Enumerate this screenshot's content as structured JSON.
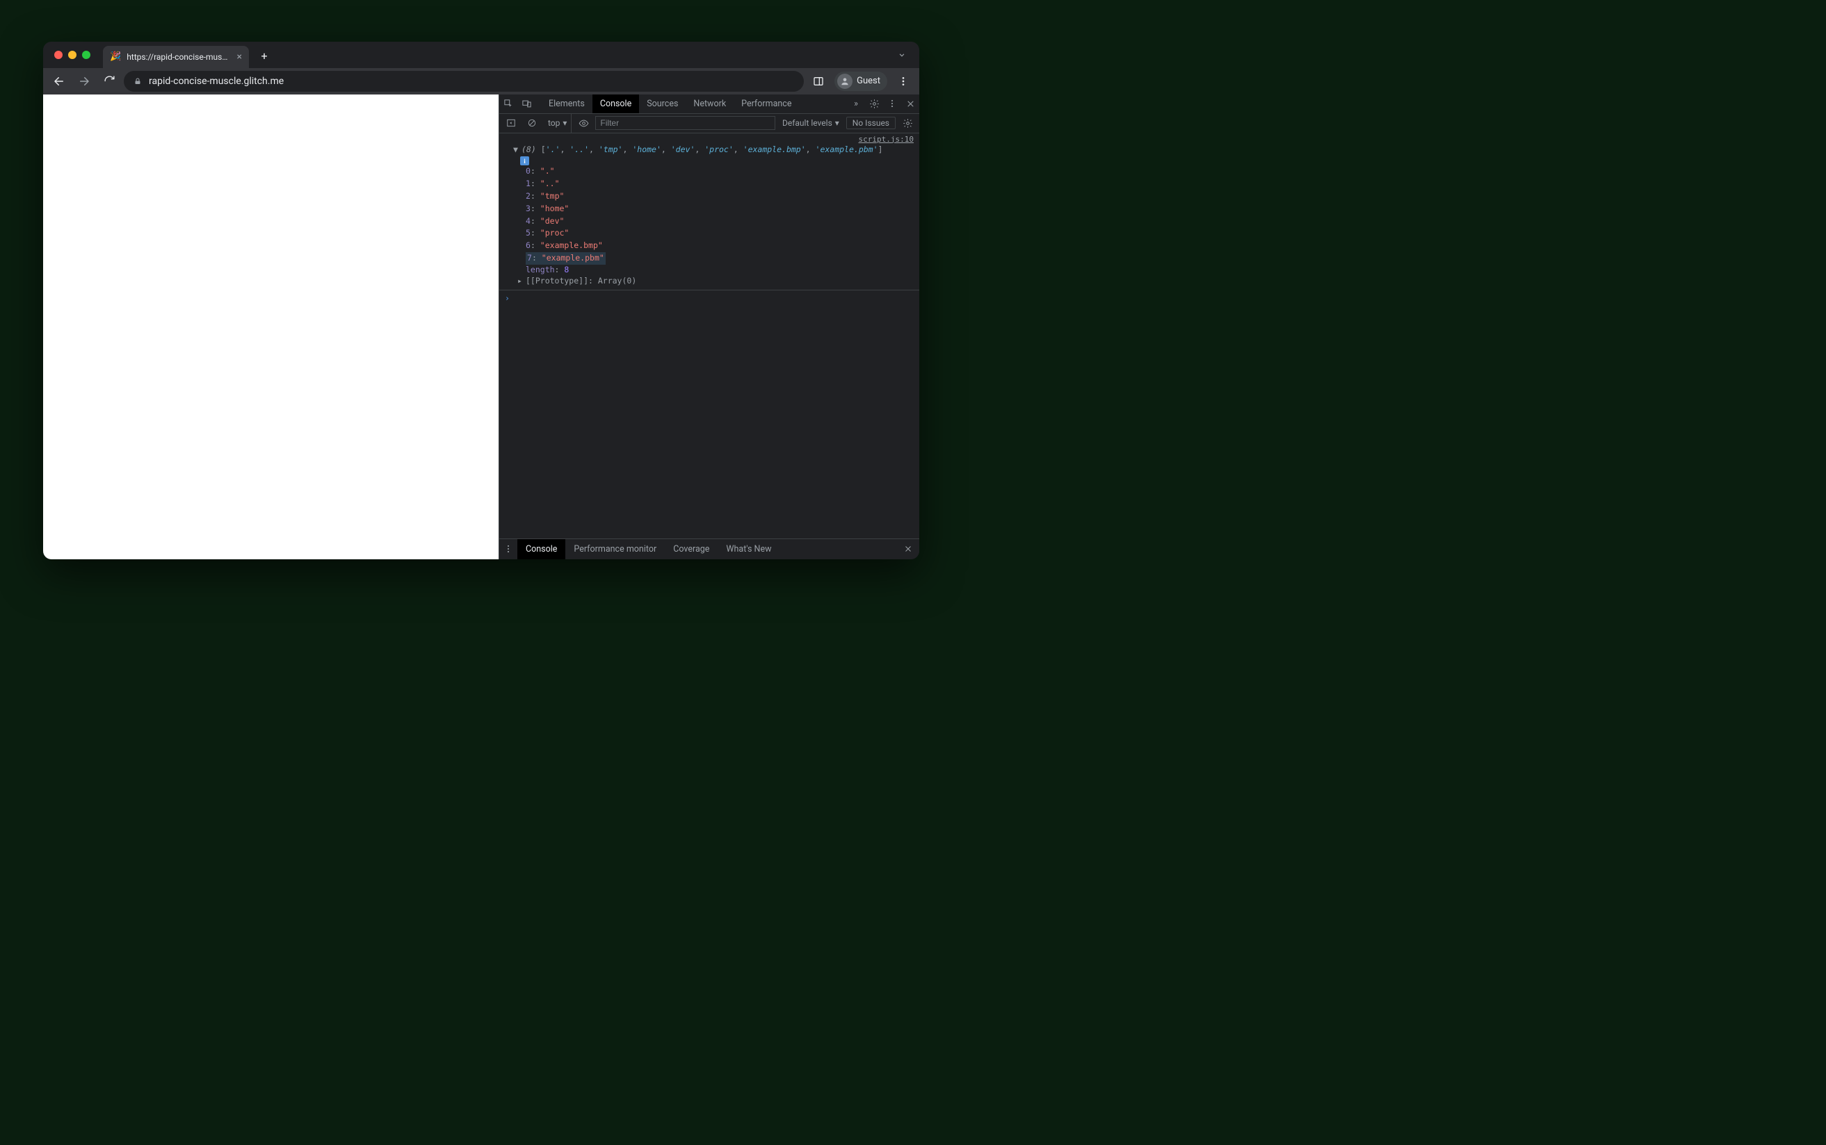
{
  "browser": {
    "tab": {
      "favicon": "🎉",
      "title": "https://rapid-concise-muscle.g"
    },
    "omnibox": {
      "url": "rapid-concise-muscle.glitch.me"
    },
    "guest_label": "Guest"
  },
  "devtools": {
    "tabs": [
      "Elements",
      "Console",
      "Sources",
      "Network",
      "Performance"
    ],
    "active_tab": "Console",
    "more_tabs_glyph": "»",
    "controls": {
      "context": "top",
      "filter_placeholder": "Filter",
      "levels": "Default levels",
      "issues": "No Issues"
    },
    "source_link": "script.js:10",
    "log": {
      "length_label": "(8)",
      "summary_items": [
        ".",
        "..",
        "tmp",
        "home",
        "dev",
        "proc",
        "example.bmp",
        "example.pbm"
      ],
      "items": [
        {
          "index": "0",
          "value": "."
        },
        {
          "index": "1",
          "value": ".."
        },
        {
          "index": "2",
          "value": "tmp"
        },
        {
          "index": "3",
          "value": "home"
        },
        {
          "index": "4",
          "value": "dev"
        },
        {
          "index": "5",
          "value": "proc"
        },
        {
          "index": "6",
          "value": "example.bmp"
        },
        {
          "index": "7",
          "value": "example.pbm"
        }
      ],
      "highlighted_index": 7,
      "length_key": "length",
      "length_value": "8",
      "prototype_text": "[[Prototype]]: Array(0)"
    },
    "prompt": "›",
    "drawer": {
      "tabs": [
        "Console",
        "Performance monitor",
        "Coverage",
        "What's New"
      ],
      "active": "Console"
    }
  }
}
